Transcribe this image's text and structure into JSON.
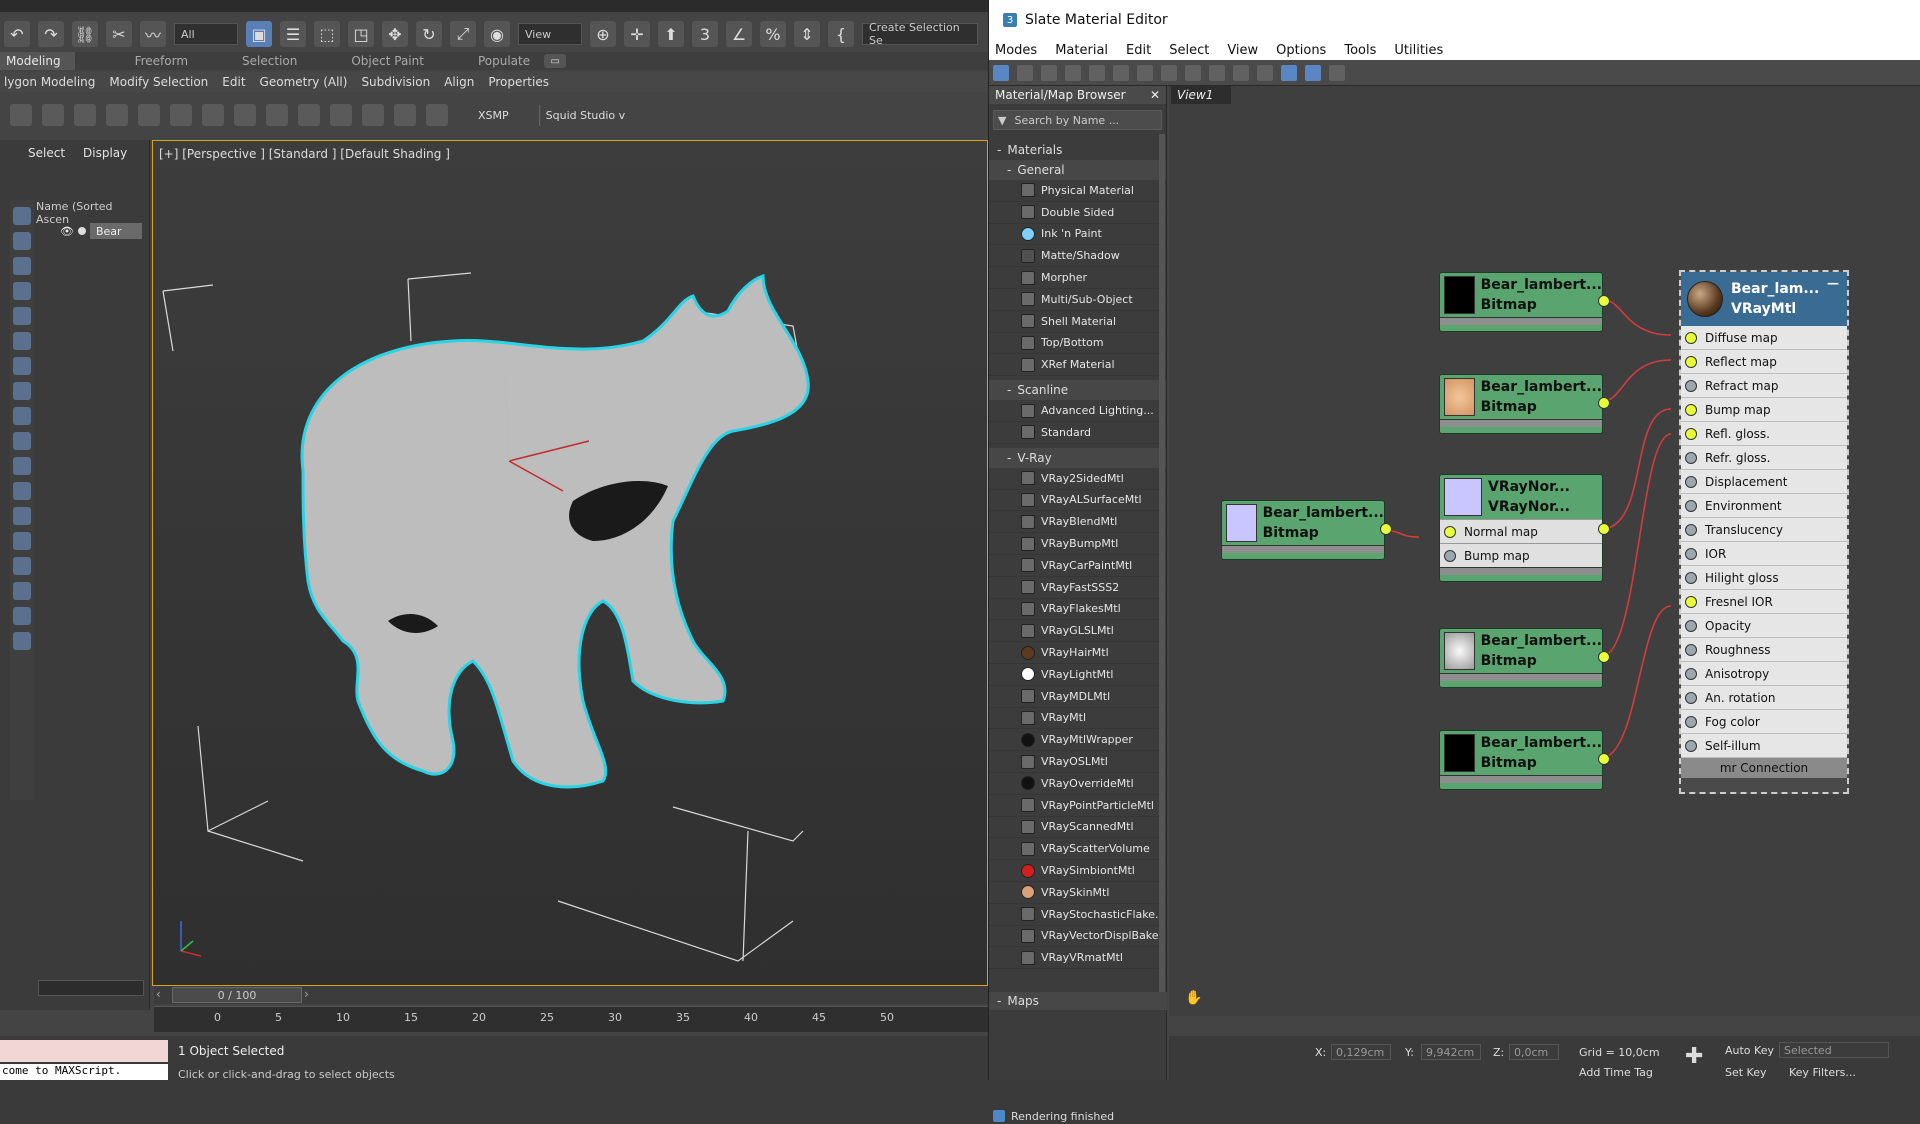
{
  "max": {
    "toolbar": {
      "selection_filter": "All",
      "view_combo": "View",
      "create_selection": "Create Selection Se"
    },
    "ribbon_tabs": [
      "Modeling",
      "Freeform",
      "Selection",
      "Object Paint",
      "Populate"
    ],
    "ribbon_sub": [
      "lygon Modeling",
      "Modify Selection",
      "Edit",
      "Geometry (All)",
      "Subdivision",
      "Align",
      "Properties"
    ],
    "ribbon_buttons": [
      "XSMP",
      "Squid Studio v"
    ],
    "explorer": {
      "tabs": [
        "Select",
        "Display"
      ],
      "header": "Name (Sorted Ascen",
      "item": "Bear"
    },
    "viewport": {
      "label": "[+] [Perspective ] [Standard ] [Default Shading ]"
    },
    "time_slider": "0 / 100",
    "timeline_ticks": [
      "0",
      "5",
      "10",
      "15",
      "20",
      "25",
      "30",
      "35",
      "40",
      "45",
      "50"
    ],
    "status": {
      "maxscript": "come to MAXScript.",
      "selected": "1 Object Selected",
      "hint": "Click or click-and-drag to select objects"
    }
  },
  "slate": {
    "title": "Slate Material Editor",
    "menu": [
      "Modes",
      "Material",
      "Edit",
      "Select",
      "View",
      "Options",
      "Tools",
      "Utilities"
    ],
    "browser": {
      "title": "Material/Map Browser",
      "search_placeholder": "Search by Name ...",
      "materials_label": "Materials",
      "general_label": "General",
      "general": [
        "Physical Material",
        "Double Sided",
        "Ink 'n Paint",
        "Matte/Shadow",
        "Morpher",
        "Multi/Sub-Object",
        "Shell Material",
        "Top/Bottom",
        "XRef Material"
      ],
      "scanline_label": "Scanline",
      "scanline": [
        "Advanced Lighting...",
        "Standard"
      ],
      "vray_label": "V-Ray",
      "vray": [
        "VRay2SidedMtl",
        "VRayALSurfaceMtl",
        "VRayBlendMtl",
        "VRayBumpMtl",
        "VRayCarPaintMtl",
        "VRayFastSSS2",
        "VRayFlakesMtl",
        "VRayGLSLMtl",
        "VRayHairMtl",
        "VRayLightMtl",
        "VRayMDLMtl",
        "VRayMtl",
        "VRayMtlWrapper",
        "VRayOSLMtl",
        "VRayOverrideMtl",
        "VRayPointParticleMtl",
        "VRayScannedMtl",
        "VRayScatterVolume",
        "VRaySimbiontMtl",
        "VRaySkinMtl",
        "VRayStochasticFlake...",
        "VRayVectorDisplBake",
        "VRayVRmatMtl"
      ],
      "maps_label": "Maps"
    },
    "view_tab": "View1",
    "render_status": "Rendering finished",
    "nodes": {
      "bitmap1": {
        "name": "Bear_lambert...",
        "type": "Bitmap"
      },
      "bitmap2": {
        "name": "Bear_lambert...",
        "type": "Bitmap"
      },
      "bitmap3": {
        "name": "Bear_lambert...",
        "type": "Bitmap"
      },
      "bitmap4": {
        "name": "Bear_lambert...",
        "type": "Bitmap"
      },
      "bitmap5": {
        "name": "Bear_lambert...",
        "type": "Bitmap"
      },
      "normal": {
        "name": "VRayNor...",
        "type": "VRayNor...",
        "ports": [
          "Normal map",
          "Bump map"
        ]
      }
    },
    "vray_node": {
      "name": "Bear_lam...",
      "type": "VRayMtl",
      "rows": [
        "Diffuse map",
        "Reflect map",
        "Refract map",
        "Bump map",
        "Refl. gloss.",
        "Refr. gloss.",
        "Displacement",
        "Environment",
        "Translucency",
        "IOR",
        "Hilight gloss",
        "Fresnel IOR",
        "Opacity",
        "Roughness",
        "Anisotropy",
        "An. rotation",
        "Fog color",
        "Self-illum"
      ],
      "connected_rows": [
        "Diffuse map",
        "Reflect map",
        "Bump map",
        "Refl. gloss.",
        "Fresnel IOR"
      ],
      "footer": "mr Connection"
    },
    "bottom": {
      "x_label": "X:",
      "x_value": "0,129cm",
      "y_label": "Y:",
      "y_value": "9,942cm",
      "z_label": "Z:",
      "z_value": "0,0cm",
      "grid": "Grid = 10,0cm",
      "auto_key": "Auto Key",
      "selected": "Selected",
      "set_key": "Set Key",
      "key_filters": "Key Filters...",
      "add_time_tag": "Add Time Tag",
      "frame": "0"
    }
  }
}
